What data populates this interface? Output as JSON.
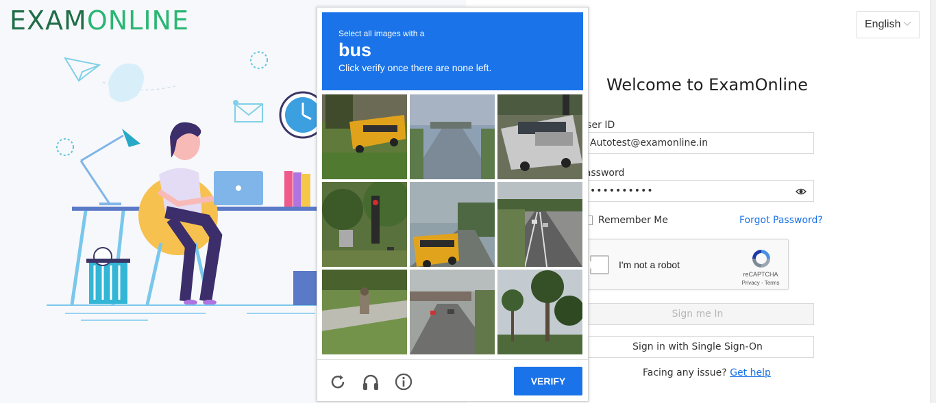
{
  "brand": {
    "logo_part1": "EXAM",
    "logo_part2": "ONLINE"
  },
  "language": {
    "selected": "English"
  },
  "login": {
    "title": "Welcome to ExamOnline",
    "user_id_label": "User ID",
    "user_id_value": "Autotest@examonline.in",
    "password_label": "Password",
    "password_value": "••••••••••",
    "remember_label": "Remember Me",
    "forgot_label": "Forgot Password?",
    "sign_in_label": "Sign me In",
    "sso_label": "Sign in with Single Sign-On",
    "facing_issue": "Facing any issue?",
    "get_help": "Get help"
  },
  "recaptcha": {
    "checkbox_label": "I'm not a robot",
    "brand": "reCAPTCHA",
    "links": "Privacy - Terms"
  },
  "challenge": {
    "line1": "Select all images with a",
    "target": "bus",
    "line3": "Click verify once there are none left.",
    "verify_label": "VERIFY",
    "tiles": [
      "school-bus-on-grass",
      "highway-road",
      "city-bus",
      "traffic-light-trees",
      "school-bus-on-road",
      "highway-lanes",
      "person-on-sidewalk",
      "street-overpass",
      "palm-trees"
    ],
    "icons": [
      "reload-icon",
      "audio-icon",
      "info-icon"
    ]
  },
  "colors": {
    "accent": "#1a73e8",
    "logo_dark": "#1f6e48",
    "logo_light": "#2ab673"
  }
}
